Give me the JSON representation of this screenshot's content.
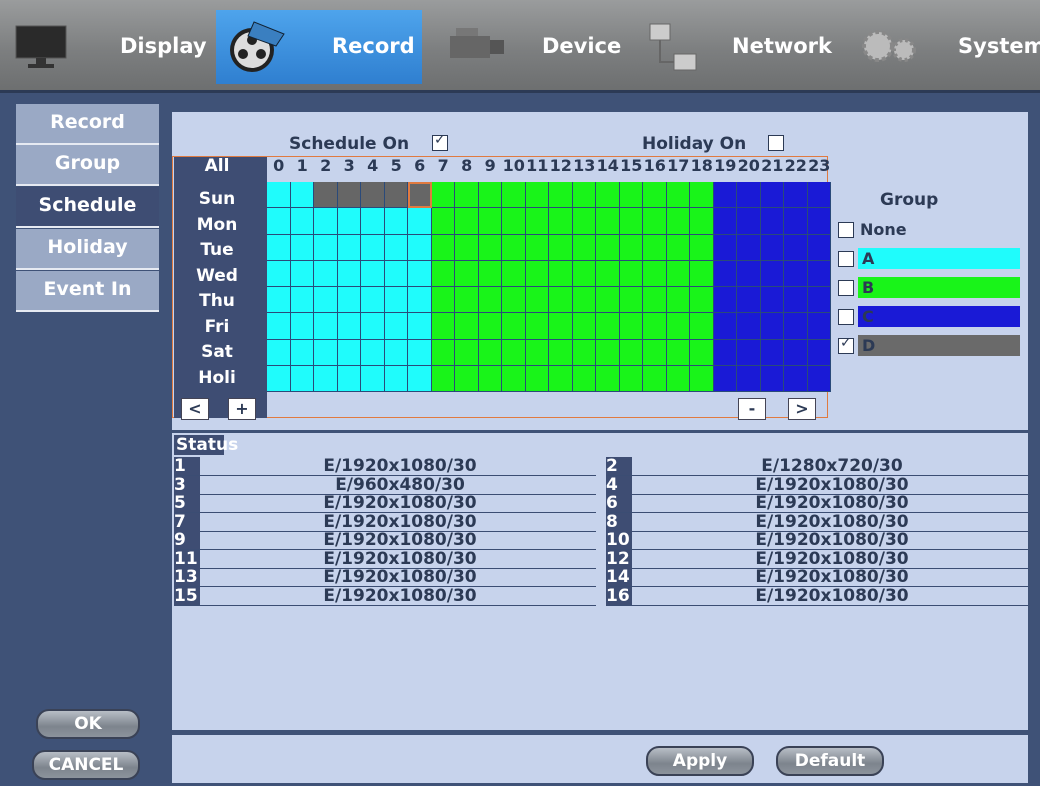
{
  "nav": {
    "tabs": [
      {
        "label": "Display",
        "icon": "monitor-icon",
        "active": false
      },
      {
        "label": "Record",
        "icon": "film-reel-icon",
        "active": true
      },
      {
        "label": "Device",
        "icon": "camera-icon",
        "active": false
      },
      {
        "label": "Network",
        "icon": "network-icon",
        "active": false
      },
      {
        "label": "System",
        "icon": "gear-icon",
        "active": false
      }
    ]
  },
  "side_menu": [
    {
      "label": "Record",
      "active": false
    },
    {
      "label": "Group",
      "active": false
    },
    {
      "label": "Schedule",
      "active": true
    },
    {
      "label": "Holiday",
      "active": false
    },
    {
      "label": "Event In",
      "active": false
    }
  ],
  "buttons": {
    "ok": "OK",
    "cancel": "CANCEL",
    "apply": "Apply",
    "default": "Default"
  },
  "schedule": {
    "schedule_on_label": "Schedule On",
    "schedule_on": true,
    "holiday_on_label": "Holiday On",
    "holiday_on": false,
    "all_label": "All",
    "hours": [
      "0",
      "1",
      "2",
      "3",
      "4",
      "5",
      "6",
      "7",
      "8",
      "9",
      "10",
      "11",
      "12",
      "13",
      "14",
      "15",
      "16",
      "17",
      "18",
      "19",
      "20",
      "21",
      "22",
      "23"
    ],
    "days": [
      "Sun",
      "Mon",
      "Tue",
      "Wed",
      "Thu",
      "Fri",
      "Sat",
      "Holi"
    ],
    "nav_prev": "<",
    "nav_plus": "+",
    "nav_minus": "-",
    "nav_next": ">",
    "grid_groups_by_hour": [
      "A",
      "A",
      "A",
      "A",
      "A",
      "A",
      "A",
      "B",
      "B",
      "B",
      "B",
      "B",
      "B",
      "B",
      "B",
      "B",
      "B",
      "B",
      "B",
      "D",
      "D",
      "D",
      "D",
      "D"
    ],
    "sunday_override": {
      "hours": [
        2,
        3,
        4,
        5,
        6
      ],
      "group": "D"
    },
    "selected_cell": {
      "day": "Sun",
      "hour": 6
    }
  },
  "group": {
    "title": "Group",
    "items": [
      {
        "label": "None",
        "checked": false,
        "color": null
      },
      {
        "label": "A",
        "checked": false,
        "color": "#1ffcfc"
      },
      {
        "label": "B",
        "checked": false,
        "color": "#19f419"
      },
      {
        "label": "C",
        "checked": false,
        "color": "#1a1ad6"
      },
      {
        "label": "D",
        "checked": true,
        "color": "#6a6a6a"
      }
    ],
    "colors": {
      "A": "#1ffcfc",
      "B": "#19f419",
      "D": "#1a1ad6",
      "gray": "#666666"
    }
  },
  "status": {
    "title": "Status",
    "channels": [
      {
        "num": "1",
        "value": "E/1920x1080/30"
      },
      {
        "num": "2",
        "value": "E/1280x720/30"
      },
      {
        "num": "3",
        "value": "E/960x480/30"
      },
      {
        "num": "4",
        "value": "E/1920x1080/30"
      },
      {
        "num": "5",
        "value": "E/1920x1080/30"
      },
      {
        "num": "6",
        "value": "E/1920x1080/30"
      },
      {
        "num": "7",
        "value": "E/1920x1080/30"
      },
      {
        "num": "8",
        "value": "E/1920x1080/30"
      },
      {
        "num": "9",
        "value": "E/1920x1080/30"
      },
      {
        "num": "10",
        "value": "E/1920x1080/30"
      },
      {
        "num": "11",
        "value": "E/1920x1080/30"
      },
      {
        "num": "12",
        "value": "E/1920x1080/30"
      },
      {
        "num": "13",
        "value": "E/1920x1080/30"
      },
      {
        "num": "14",
        "value": "E/1920x1080/30"
      },
      {
        "num": "15",
        "value": "E/1920x1080/30"
      },
      {
        "num": "16",
        "value": "E/1920x1080/30"
      }
    ]
  }
}
